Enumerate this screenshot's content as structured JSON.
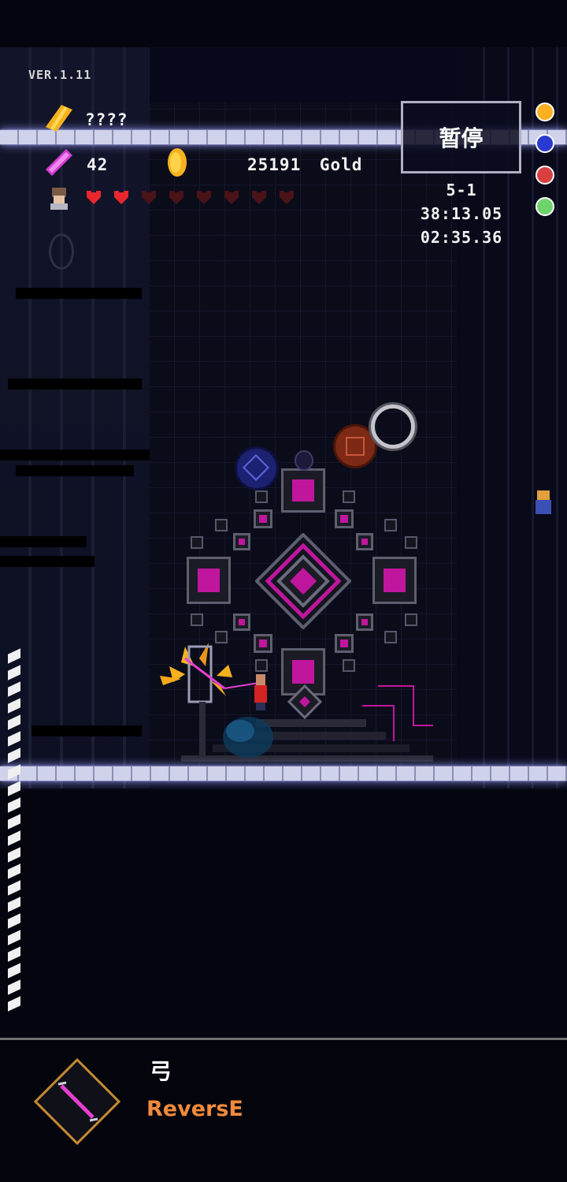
{
  "hud": {
    "version": "VER.1.11",
    "name": "????",
    "ammo": "42",
    "gold_amount": "25191",
    "gold_unit": "Gold",
    "hearts_full": 2,
    "hearts_total": 8,
    "stage": "5-1",
    "total_time": "38:13.05",
    "stage_time": "02:35.36",
    "pause_label": "暂停"
  },
  "weapon": {
    "type_label": "弓",
    "name": "ReversE"
  },
  "side_orbs": [
    {
      "name": "orange-orb-icon",
      "color": "#ffb020"
    },
    {
      "name": "blue-orb-icon",
      "color": "#2a3ad0"
    },
    {
      "name": "red-orb-icon",
      "color": "#d84040"
    },
    {
      "name": "green-orb-icon",
      "color": "#6fd36b"
    }
  ],
  "colors": {
    "accent_magenta": "#c0169d",
    "weapon_name": "#f08a3c",
    "gold": "#f6b21e"
  }
}
